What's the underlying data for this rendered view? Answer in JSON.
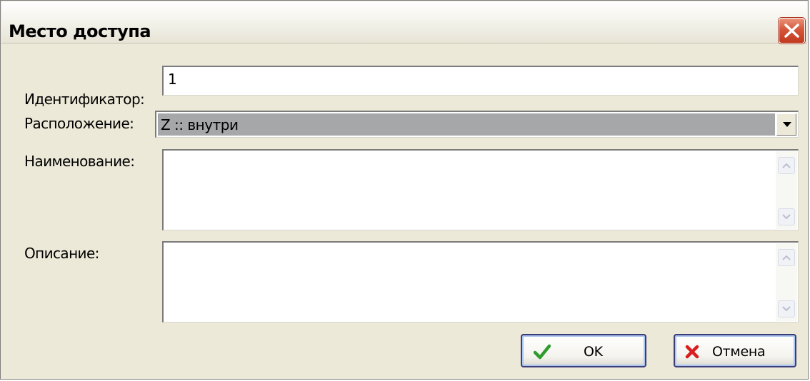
{
  "window": {
    "title": "Место доступа",
    "close_icon": "close-icon"
  },
  "form": {
    "identifier": {
      "label": "Идентификатор:",
      "value": "1"
    },
    "location": {
      "label": "Расположение:",
      "value": "Z :: внутри",
      "icon": "chevron-down-icon"
    },
    "name": {
      "label": "Наименование:",
      "value": ""
    },
    "description": {
      "label": "Описание:",
      "value": ""
    }
  },
  "buttons": {
    "ok": {
      "label": "OK",
      "icon": "checkmark-icon",
      "icon_color": "#2e9b2e"
    },
    "cancel": {
      "label": "Отмена",
      "icon": "x-icon",
      "icon_color": "#d81e1e"
    }
  },
  "colors": {
    "window_bg": "#ece9d8",
    "close_button": "#d5573a",
    "selection_bg": "#a6a7a8",
    "button_border": "#3c3c78"
  }
}
